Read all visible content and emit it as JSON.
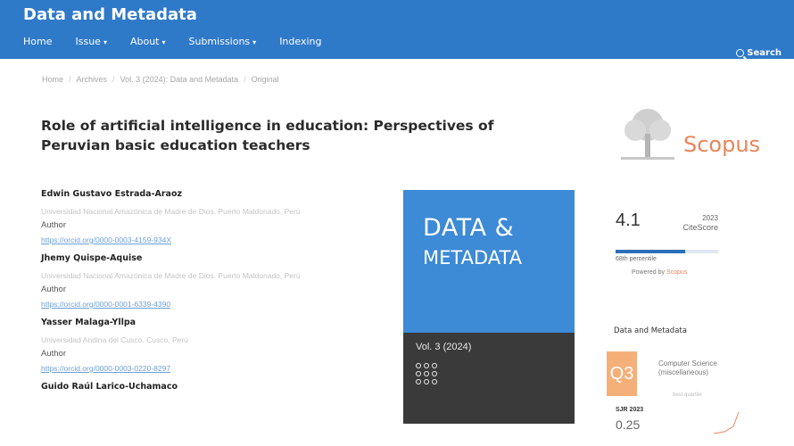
{
  "header": {
    "site_title": "Data and Metadata",
    "nav": [
      "Home",
      "Issue",
      "About",
      "Submissions",
      "Indexing"
    ],
    "search_label": "Search"
  },
  "breadcrumb": [
    "Home",
    "Archives",
    "Vol. 3 (2024): Data and Metadata",
    "Original"
  ],
  "article": {
    "title": "Role of artificial intelligence in education: Perspectives of Peruvian basic education teachers",
    "authors": [
      {
        "name": "Edwin Gustavo Estrada-Araoz",
        "affiliation": "Universidad Nacional Amazónica de Madre de Dios. Puerto Maldonado, Perú",
        "role": "Author",
        "orcid": "https://orcid.org/0000-0003-4159-934X"
      },
      {
        "name": "Jhemy Quispe-Aquise",
        "affiliation": "Universidad Nacional Amazónica de Madre de Dios. Puerto Maldonado, Perú",
        "role": "Author",
        "orcid": "https://orcid.org/0000-0001-6339-4390"
      },
      {
        "name": "Yasser Malaga-Yllpa",
        "affiliation": "Universidad Andina del Cusco. Cusco, Perú",
        "role": "Author",
        "orcid": "https://orcid.org/0000-0003-0220-8297"
      },
      {
        "name": "Guido Raúl Larico-Uchamaco",
        "affiliation": "",
        "role": "",
        "orcid": ""
      }
    ]
  },
  "cover": {
    "line1": "DATA &",
    "line2": "METADATA",
    "volume": "Vol. 3 (2024)",
    "color_top": "#3d8ad6",
    "color_bottom": "#3a3a3a"
  },
  "scopus": {
    "logo_word": "Scopus",
    "citescore_value": "4.1",
    "citescore_year": "2023",
    "citescore_label": "CiteScore",
    "percentile_text": "68th percentile",
    "percentile": 0.68,
    "powered_prefix": "Powered by",
    "powered_brand": "Scopus"
  },
  "sjr": {
    "heading": "Data and Metadata",
    "quartile": "Q3",
    "category": "Computer Science (miscellaneous)",
    "best_quartile": "best quartile",
    "year_label": "SJR 2023",
    "value": "0.25"
  },
  "colors": {
    "header_bg": "#2f79c9",
    "link": "#6b9fd6",
    "scopus_orange": "#e9845a",
    "quartile_orange": "#f5b07a"
  }
}
